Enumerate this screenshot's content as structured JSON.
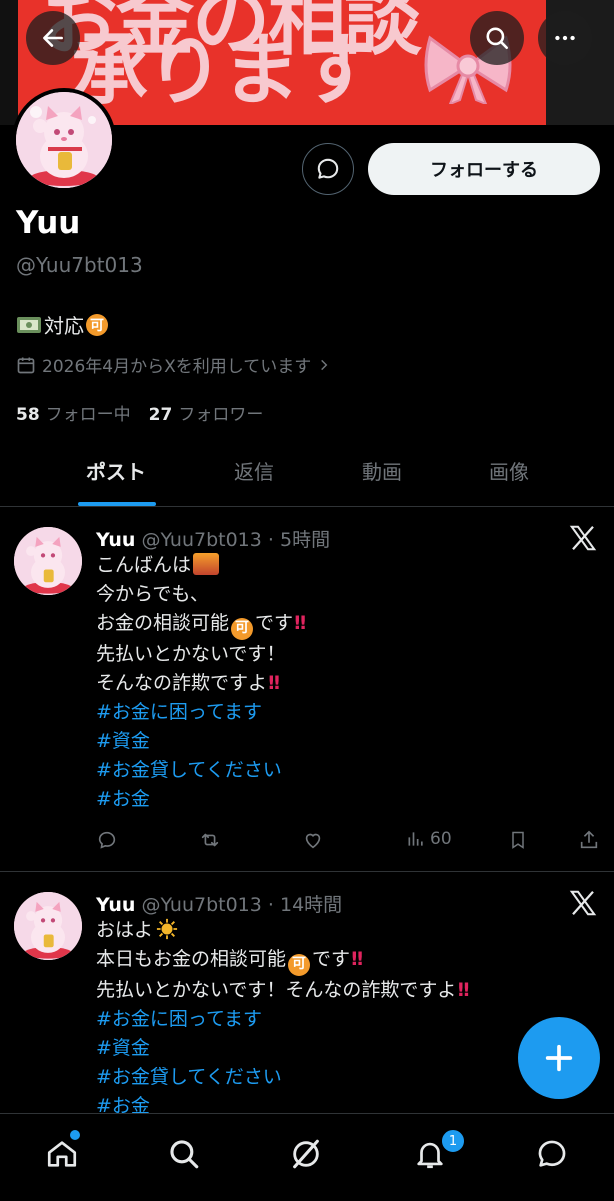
{
  "banner": {
    "text_top": "お金の相談",
    "text_main": "承ります"
  },
  "profile": {
    "name": "Yuu",
    "handle": "@Yuu7bt013",
    "bio_text": "対応",
    "bio_badge": "可",
    "joined": "2026年4月からXを利用しています",
    "following_count": "58",
    "following_label": "フォロー中",
    "followers_count": "27",
    "followers_label": "フォロワー",
    "follow_button": "フォローする"
  },
  "tabs": [
    {
      "label": "ポスト",
      "active": true
    },
    {
      "label": "返信",
      "active": false
    },
    {
      "label": "動画",
      "active": false
    },
    {
      "label": "画像",
      "active": false
    }
  ],
  "posts": [
    {
      "name": "Yuu",
      "handle": "@Yuu7bt013",
      "time": "· 5時間",
      "line1": "こんばんは",
      "line2": "今からでも、",
      "line3a": "お金の相談可能",
      "line3b": "です",
      "line4": "先払いとかないです！",
      "line5": "そんなの詐欺ですよ",
      "hashtags": [
        "#お金に困ってます",
        "#資金",
        "#お金貸してください",
        "#お金"
      ],
      "views": "60"
    },
    {
      "name": "Yuu",
      "handle": "@Yuu7bt013",
      "time": "· 14時間",
      "line1": "おはよ",
      "line2a": "本日もお金の相談可能",
      "line2b": "です",
      "line3": "先払いとかないです！そんなの詐欺ですよ",
      "hashtags": [
        "#お金に困ってます",
        "#資金",
        "#お金貸してください",
        "#お金"
      ]
    }
  ],
  "badge_char": "可",
  "notification_count": "1",
  "colors": {
    "accent": "#1d9bf0",
    "banner_red": "#e8322a",
    "muted": "#71767b"
  },
  "icons": [
    "back-arrow-icon",
    "search-icon",
    "more-icon",
    "message-icon",
    "calendar-icon",
    "x-logo-icon",
    "reply-icon",
    "repost-icon",
    "like-icon",
    "views-icon",
    "bookmark-icon",
    "share-icon",
    "plus-icon",
    "home-icon",
    "grok-icon",
    "bell-icon",
    "chat-icon"
  ]
}
